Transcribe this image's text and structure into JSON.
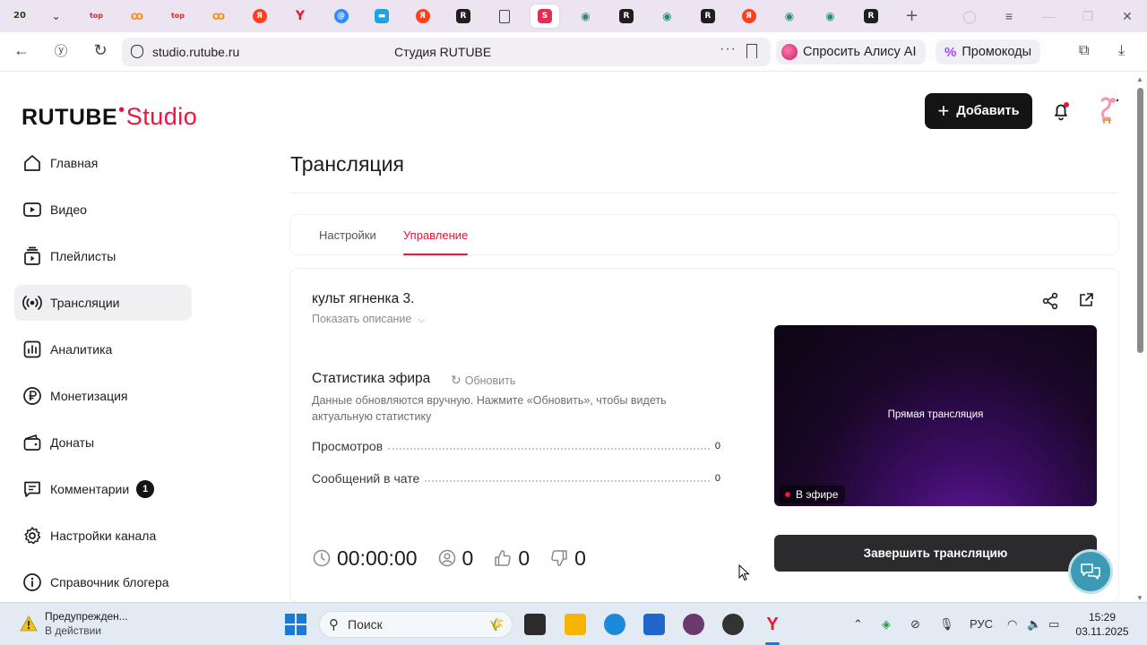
{
  "browser": {
    "first_tab_label": "20",
    "tab_favicons": [
      "top-icon",
      "ok-icon",
      "top-icon",
      "ok-icon",
      "yandex-icon",
      "y-icon",
      "at-icon",
      "chat-icon",
      "yandex-icon",
      "r-icon",
      "doc-icon",
      "studio-icon",
      "gamepad-icon",
      "r-icon",
      "gamepad-icon",
      "r-icon",
      "yandex-icon",
      "gamepad-icon",
      "gamepad-icon",
      "r-icon"
    ],
    "url": "studio.rutube.ru",
    "page_title": "Студия RUTUBE",
    "alice_label": "Спросить Алису AI",
    "promo_label": "Промокоды"
  },
  "app": {
    "logo_main": "RUTUBE",
    "logo_studio": "Studio",
    "add_button_label": "Добавить",
    "accent_color": "#ed143b"
  },
  "sidebar": {
    "items": [
      {
        "label": "Главная"
      },
      {
        "label": "Видео"
      },
      {
        "label": "Плейлисты"
      },
      {
        "label": "Трансляции"
      },
      {
        "label": "Аналитика"
      },
      {
        "label": "Монетизация"
      },
      {
        "label": "Донаты"
      },
      {
        "label": "Комментарии",
        "badge": "1"
      },
      {
        "label": "Настройки канала"
      },
      {
        "label": "Справочник блогера"
      }
    ]
  },
  "main": {
    "title": "Трансляция",
    "tabs": [
      {
        "label": "Настройки",
        "active": false
      },
      {
        "label": "Управление",
        "active": true
      }
    ],
    "stream_name": "культ ягненка 3.",
    "show_description": "Показать описание",
    "stats": {
      "title": "Статистика эфира",
      "refresh_label": "Обновить",
      "description": "Данные обновляются вручную. Нажмите «Обновить», чтобы видеть актуальную статистику",
      "rows": [
        {
          "label": "Просмотров",
          "value": "0"
        },
        {
          "label": "Сообщений в чате",
          "value": "0"
        }
      ]
    },
    "bottom": {
      "duration": "00:00:00",
      "viewers": "0",
      "likes": "0",
      "dislikes": "0"
    },
    "preview": {
      "label": "Прямая трансляция",
      "live_label": "В эфире"
    },
    "end_button_label": "Завершить трансляцию"
  },
  "taskbar": {
    "warning_title": "Предупрежден...",
    "warning_sub": "В действии",
    "search_label": "Поиск",
    "language": "РУС",
    "time": "15:29",
    "date": "03.11.2025"
  }
}
